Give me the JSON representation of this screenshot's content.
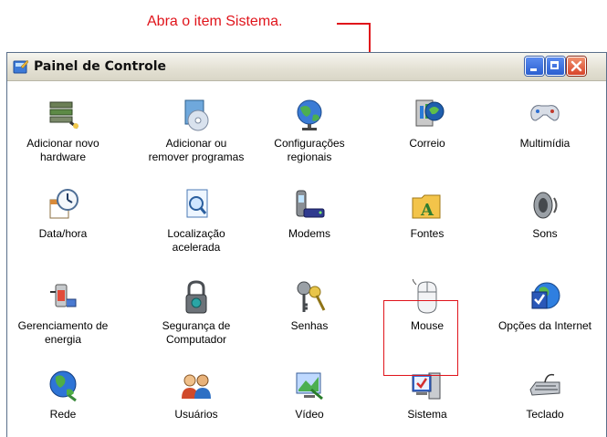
{
  "callout": {
    "text": "Abra o item Sistema."
  },
  "window": {
    "title": "Painel de Controle",
    "buttons": [
      "minimize",
      "maximize",
      "close"
    ]
  },
  "items": [
    {
      "label": "Adicionar novo\nhardware",
      "icon": "hardware-icon"
    },
    {
      "label": "Adicionar ou\nremover programas",
      "icon": "add-remove-programs-icon"
    },
    {
      "label": "Configurações\nregionais",
      "icon": "globe-icon"
    },
    {
      "label": "Correio",
      "icon": "mail-icon"
    },
    {
      "label": "Multimídia",
      "icon": "gamepad-icon"
    },
    {
      "label": "Data/hora",
      "icon": "clock-icon"
    },
    {
      "label": "Localização\nacelerada",
      "icon": "search-document-icon"
    },
    {
      "label": "Modems",
      "icon": "modem-icon"
    },
    {
      "label": "Fontes",
      "icon": "fonts-folder-icon"
    },
    {
      "label": "Sons",
      "icon": "speaker-icon"
    },
    {
      "label": "Gerenciamento de\nenergia",
      "icon": "power-icon"
    },
    {
      "label": "Segurança de\nComputador",
      "icon": "padlock-icon"
    },
    {
      "label": "Senhas",
      "icon": "keys-icon"
    },
    {
      "label": "Mouse",
      "icon": "mouse-icon"
    },
    {
      "label": "Opções da Internet",
      "icon": "internet-options-icon"
    },
    {
      "label": "Rede",
      "icon": "network-globe-icon"
    },
    {
      "label": "Usuários",
      "icon": "users-icon"
    },
    {
      "label": "Vídeo",
      "icon": "display-icon"
    },
    {
      "label": "Sistema",
      "icon": "system-icon"
    },
    {
      "label": "Teclado",
      "icon": "keyboard-icon"
    }
  ]
}
